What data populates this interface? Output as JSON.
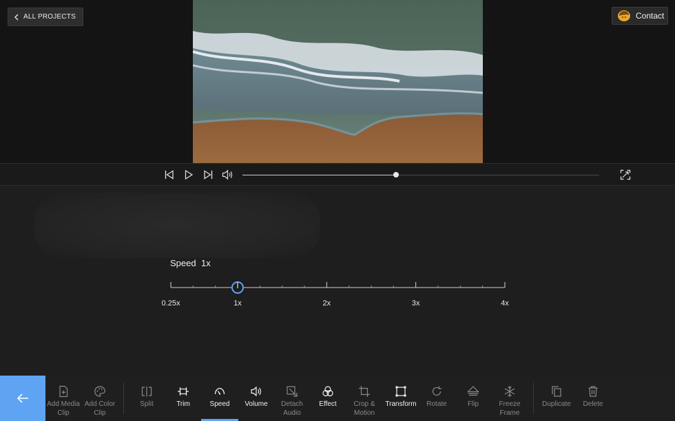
{
  "header": {
    "all_projects_label": "ALL PROJECTS",
    "contact_label": "Contact"
  },
  "playback": {
    "progress": 0.43
  },
  "speed_panel": {
    "label": "Speed",
    "value": "1x",
    "ticks": [
      "0.25x",
      "1x",
      "2x",
      "3x",
      "4x"
    ],
    "current": 1
  },
  "toolbar": {
    "back_label": "",
    "tools": [
      {
        "id": "add-media-clip",
        "label": "Add Media\nClip",
        "icon": "add-media-icon"
      },
      {
        "id": "add-color-clip",
        "label": "Add Color\nClip",
        "icon": "palette-icon"
      },
      {
        "id": "split",
        "label": "Split",
        "icon": "split-icon"
      },
      {
        "id": "trim",
        "label": "Trim",
        "icon": "trim-icon"
      },
      {
        "id": "speed",
        "label": "Speed",
        "icon": "speedometer-icon"
      },
      {
        "id": "volume",
        "label": "Volume",
        "icon": "volume-icon"
      },
      {
        "id": "detach-audio",
        "label": "Detach\nAudio",
        "icon": "detach-audio-icon"
      },
      {
        "id": "effect",
        "label": "Effect",
        "icon": "effect-icon"
      },
      {
        "id": "crop-motion",
        "label": "Crop &\nMotion",
        "icon": "crop-icon"
      },
      {
        "id": "transform",
        "label": "Transform",
        "icon": "transform-icon"
      },
      {
        "id": "rotate",
        "label": "Rotate",
        "icon": "rotate-icon"
      },
      {
        "id": "flip",
        "label": "Flip",
        "icon": "flip-icon"
      },
      {
        "id": "freeze-frame",
        "label": "Freeze\nFrame",
        "icon": "snowflake-icon"
      },
      {
        "id": "duplicate",
        "label": "Duplicate",
        "icon": "duplicate-icon"
      },
      {
        "id": "delete",
        "label": "Delete",
        "icon": "trash-icon"
      }
    ]
  },
  "colors": {
    "accent": "#5ea4f2",
    "panel": "#1e1e1e",
    "preview": "#141414"
  }
}
